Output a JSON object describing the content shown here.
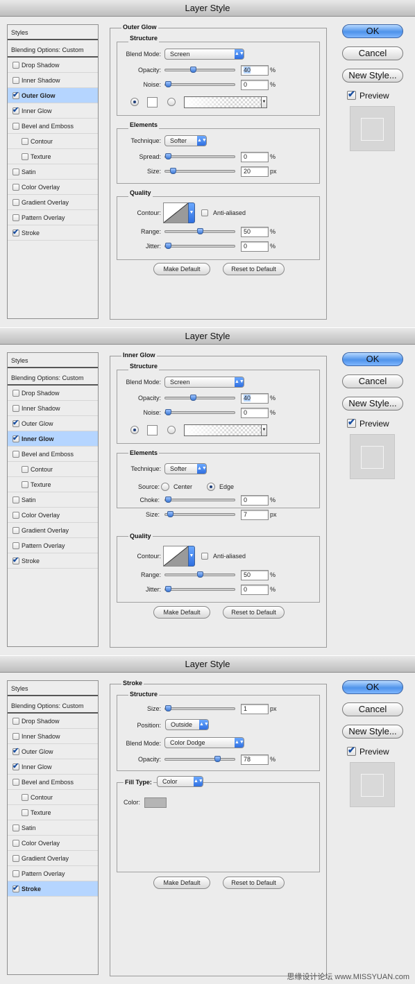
{
  "dialog_title": "Layer Style",
  "buttons": {
    "ok": "OK",
    "cancel": "Cancel",
    "new_style": "New Style...",
    "preview": "Preview",
    "make_default": "Make Default",
    "reset_default": "Reset to Default"
  },
  "sidebar": {
    "styles": "Styles",
    "blending": "Blending Options: Custom",
    "items": [
      "Drop Shadow",
      "Inner Shadow",
      "Outer Glow",
      "Inner Glow",
      "Bevel and Emboss",
      "Contour",
      "Texture",
      "Satin",
      "Color Overlay",
      "Gradient Overlay",
      "Pattern Overlay",
      "Stroke"
    ]
  },
  "checked_items": [
    "Outer Glow",
    "Inner Glow",
    "Stroke"
  ],
  "outer_glow": {
    "title": "Outer Glow",
    "structure": {
      "title": "Structure",
      "blend_mode_label": "Blend Mode:",
      "blend_mode": "Screen",
      "opacity_label": "Opacity:",
      "opacity": "40",
      "opacity_unit": "%",
      "noise_label": "Noise:",
      "noise": "0",
      "noise_unit": "%"
    },
    "elements": {
      "title": "Elements",
      "technique_label": "Technique:",
      "technique": "Softer",
      "spread_label": "Spread:",
      "spread": "0",
      "spread_unit": "%",
      "size_label": "Size:",
      "size": "20",
      "size_unit": "px"
    },
    "quality": {
      "title": "Quality",
      "contour_label": "Contour:",
      "anti_aliased": "Anti-aliased",
      "range_label": "Range:",
      "range": "50",
      "range_unit": "%",
      "jitter_label": "Jitter:",
      "jitter": "0",
      "jitter_unit": "%"
    }
  },
  "inner_glow": {
    "title": "Inner Glow",
    "structure": {
      "title": "Structure",
      "blend_mode_label": "Blend Mode:",
      "blend_mode": "Screen",
      "opacity_label": "Opacity:",
      "opacity": "40",
      "opacity_unit": "%",
      "noise_label": "Noise:",
      "noise": "0",
      "noise_unit": "%"
    },
    "elements": {
      "title": "Elements",
      "technique_label": "Technique:",
      "technique": "Softer",
      "source_label": "Source:",
      "center": "Center",
      "edge": "Edge",
      "choke_label": "Choke:",
      "choke": "0",
      "choke_unit": "%",
      "size_label": "Size:",
      "size": "7",
      "size_unit": "px"
    },
    "quality": {
      "title": "Quality",
      "contour_label": "Contour:",
      "anti_aliased": "Anti-aliased",
      "range_label": "Range:",
      "range": "50",
      "range_unit": "%",
      "jitter_label": "Jitter:",
      "jitter": "0",
      "jitter_unit": "%"
    }
  },
  "stroke": {
    "title": "Stroke",
    "structure": {
      "title": "Structure",
      "size_label": "Size:",
      "size": "1",
      "size_unit": "px",
      "position_label": "Position:",
      "position": "Outside",
      "blend_mode_label": "Blend Mode:",
      "blend_mode": "Color Dodge",
      "opacity_label": "Opacity:",
      "opacity": "78",
      "opacity_unit": "%"
    },
    "fill_type_label": "Fill Type:",
    "fill_type": "Color",
    "color_label": "Color:",
    "color": "#b5b5b5"
  },
  "slider_levels": {
    "outer_glow": {
      "opacity": 0.4,
      "noise": 0,
      "spread": 0,
      "size": 0.08,
      "range": 0.5,
      "jitter": 0
    },
    "inner_glow": {
      "opacity": 0.4,
      "noise": 0,
      "choke": 0,
      "size": 0.03,
      "range": 0.5,
      "jitter": 0
    },
    "stroke": {
      "size": 0,
      "opacity": 0.78
    }
  },
  "colors": {
    "accent": "#4f93ea",
    "selection": "#b5d5ff"
  },
  "watermark": "思缘设计论坛 www.MISSYUAN.com"
}
